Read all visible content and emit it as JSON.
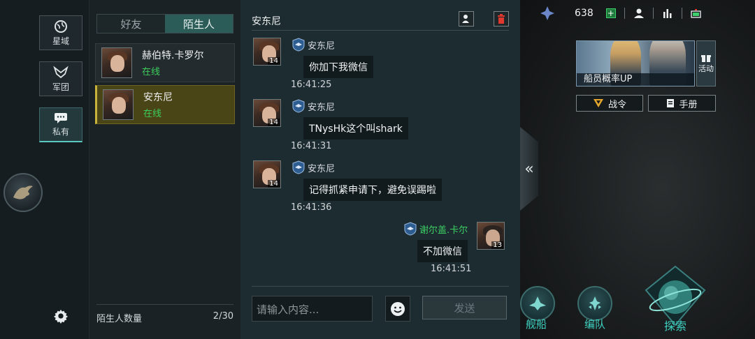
{
  "rail": {
    "items": [
      {
        "label": "星域",
        "icon": "globe-icon"
      },
      {
        "label": "军团",
        "icon": "legion-emblem-icon"
      },
      {
        "label": "私有",
        "icon": "chat-bubble-icon",
        "active": true
      }
    ]
  },
  "list": {
    "tabs": [
      {
        "label": "好友",
        "active": false
      },
      {
        "label": "陌生人",
        "active": true
      }
    ],
    "contacts": [
      {
        "name": "赫伯特.卡罗尔",
        "status": "在线",
        "selected": false
      },
      {
        "name": "安东尼",
        "status": "在线",
        "selected": true
      }
    ],
    "stranger_count_label": "陌生人数量",
    "stranger_count_value": "2/30"
  },
  "chat": {
    "title": "安东尼",
    "messages": [
      {
        "sender": "安东尼",
        "level": "14",
        "text": "你加下我微信",
        "time": "16:41:25",
        "mine": false
      },
      {
        "sender": "安东尼",
        "level": "14",
        "text": "TNysHk这个叫shark",
        "time": "16:41:31",
        "mine": false
      },
      {
        "sender": "安东尼",
        "level": "14",
        "text": "记得抓紧申请下，避免误踢啦",
        "time": "16:41:36",
        "mine": false
      },
      {
        "sender": "谢尔盖.卡尔",
        "level": "13",
        "text": "不加微信",
        "time": "16:41:51",
        "mine": true
      }
    ],
    "input_placeholder": "请输入内容...",
    "send_label": "发送"
  },
  "game": {
    "resource_value": "638",
    "banner_label": "船员概率UP",
    "activity_label": "活动",
    "battle_pass_label": "战令",
    "manual_label": "手册",
    "nav": [
      {
        "label": "舰船"
      },
      {
        "label": "编队"
      },
      {
        "label": "探索"
      }
    ],
    "colors": {
      "online": "#3ccf5c",
      "accent_teal": "#3ed2c3",
      "selected_gold": "#cbb43e"
    }
  }
}
